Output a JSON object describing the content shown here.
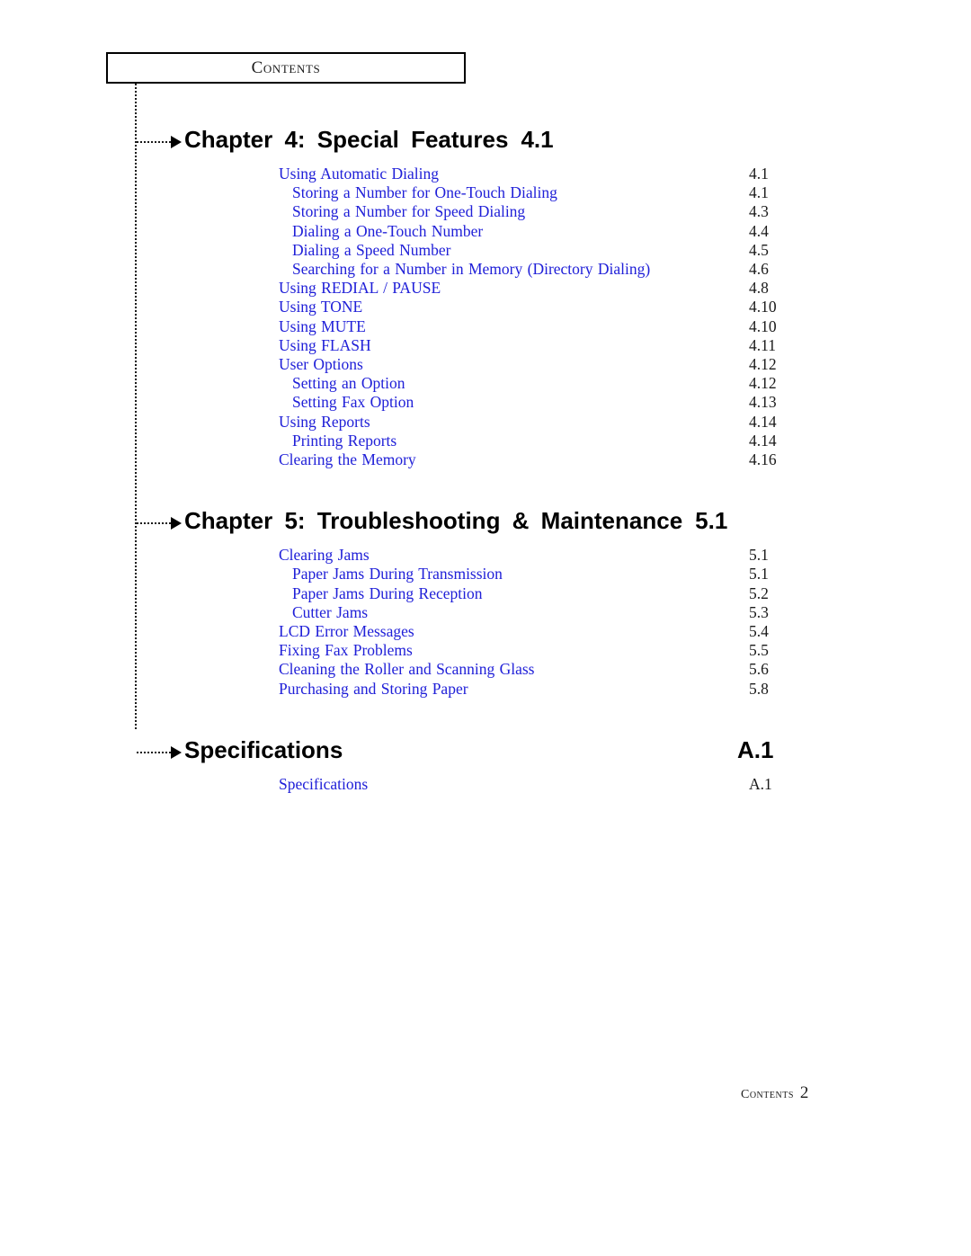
{
  "header": {
    "label": "Contents"
  },
  "sections": [
    {
      "kind": "chapter",
      "title": "Chapter 4:  Special  Features",
      "page": "4.1",
      "entries": [
        {
          "level": 1,
          "label": "Using Automatic Dialing",
          "page": "4.1"
        },
        {
          "level": 2,
          "label": "Storing a Number for One-Touch Dialing",
          "page": "4.1"
        },
        {
          "level": 2,
          "label": "Storing a Number for Speed Dialing",
          "page": "4.3"
        },
        {
          "level": 2,
          "label": "Dialing a One-Touch Number",
          "page": "4.4"
        },
        {
          "level": 2,
          "label": "Dialing a Speed Number",
          "page": "4.5"
        },
        {
          "level": 2,
          "label": "Searching for a Number in Memory (Directory Dialing)",
          "page": "4.6"
        },
        {
          "level": 1,
          "label": "Using REDIAL / PAUSE",
          "page": "4.8"
        },
        {
          "level": 1,
          "label": "Using TONE",
          "page": "4.10"
        },
        {
          "level": 1,
          "label": "Using MUTE",
          "page": "4.10"
        },
        {
          "level": 1,
          "label": "Using FLASH",
          "page": "4.11"
        },
        {
          "level": 1,
          "label": "User Options",
          "page": "4.12"
        },
        {
          "level": 2,
          "label": "Setting an Option",
          "page": "4.12"
        },
        {
          "level": 2,
          "label": "Setting Fax Option",
          "page": "4.13"
        },
        {
          "level": 1,
          "label": "Using Reports",
          "page": "4.14"
        },
        {
          "level": 2,
          "label": "Printing Reports",
          "page": "4.14"
        },
        {
          "level": 1,
          "label": "Clearing the Memory",
          "page": "4.16"
        }
      ]
    },
    {
      "kind": "chapter",
      "title": "Chapter 5:  Troubleshooting  &  Maintenance",
      "page": "5.1",
      "entries": [
        {
          "level": 1,
          "label": "Clearing Jams",
          "page": "5.1"
        },
        {
          "level": 2,
          "label": "Paper Jams During Transmission",
          "page": "5.1"
        },
        {
          "level": 2,
          "label": "Paper Jams During Reception",
          "page": "5.2"
        },
        {
          "level": 2,
          "label": "Cutter Jams",
          "page": "5.3"
        },
        {
          "level": 1,
          "label": "LCD Error Messages",
          "page": "5.4"
        },
        {
          "level": 1,
          "label": "Fixing Fax Problems",
          "page": "5.5"
        },
        {
          "level": 1,
          "label": "Cleaning the Roller and Scanning Glass",
          "page": "5.6"
        },
        {
          "level": 1,
          "label": "Purchasing and Storing Paper",
          "page": "5.8"
        }
      ]
    },
    {
      "kind": "appendix",
      "title": "Specifications",
      "page": "A.1",
      "entries": [
        {
          "level": 1,
          "label": "Specifications",
          "page": "A.1"
        }
      ]
    }
  ],
  "footer": {
    "label": "Contents",
    "page_number": "2"
  },
  "colors": {
    "entry_text": "#2020d8",
    "heading_text": "#000000",
    "page_number_text": "#1a1a1a",
    "rule": "#000000",
    "background": "#ffffff"
  }
}
